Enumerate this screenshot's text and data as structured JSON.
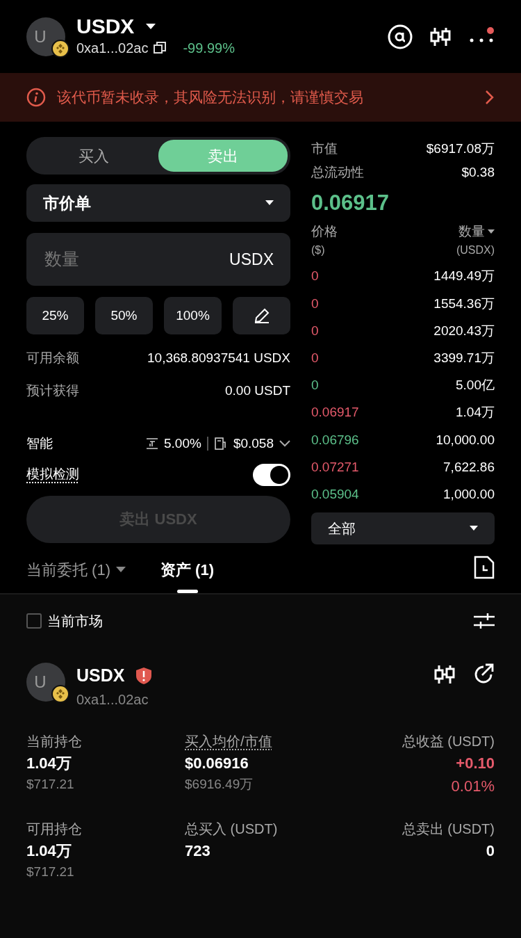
{
  "token": {
    "symbol": "USDX",
    "avatar_letter": "U",
    "address": "0xa1...02ac",
    "change": "-99.99%",
    "has_notification": true
  },
  "warning": {
    "text": "该代币暂未收录，其风险无法识别，请谨慎交易"
  },
  "trade": {
    "sides": [
      {
        "label": "买入",
        "selected": false
      },
      {
        "label": "卖出",
        "selected": true
      }
    ],
    "order_type": "市价单",
    "amount": {
      "placeholder": "数量",
      "unit": "USDX"
    },
    "presets": [
      "25%",
      "50%",
      "100%"
    ],
    "available": {
      "label": "可用余额",
      "value": "10,368.80937541 USDX"
    },
    "estimated": {
      "label": "预计获得",
      "value": "0.00 USDT"
    },
    "mode": {
      "label": "智能",
      "slippage": "5.00%",
      "gas": "$0.058"
    },
    "simulation": {
      "label": "模拟检测",
      "on": true
    },
    "submit": {
      "label": "卖出 USDX",
      "disabled": true
    }
  },
  "market": {
    "stats": [
      {
        "label": "市值",
        "value": "$6917.08万"
      },
      {
        "label": "总流动性",
        "value": "$0.38"
      }
    ],
    "price": "0.06917",
    "columns": [
      {
        "label": "价格",
        "unit": "($)"
      },
      {
        "label": "数量",
        "unit": "(USDX)"
      }
    ],
    "trades": [
      {
        "price": "0",
        "amount": "1449.49万",
        "kind": "sell"
      },
      {
        "price": "0",
        "amount": "1554.36万",
        "kind": "sell"
      },
      {
        "price": "0",
        "amount": "2020.43万",
        "kind": "sell"
      },
      {
        "price": "0",
        "amount": "3399.71万",
        "kind": "sell"
      },
      {
        "price": "0",
        "amount": "5.00亿",
        "kind": "buy"
      },
      {
        "price": "0.06917",
        "amount": "1.04万",
        "kind": "sell"
      },
      {
        "price": "0.06796",
        "amount": "10,000.00",
        "kind": "buy"
      },
      {
        "price": "0.07271",
        "amount": "7,622.86",
        "kind": "sell"
      },
      {
        "price": "0.05904",
        "amount": "1,000.00",
        "kind": "buy"
      }
    ],
    "filter": "全部"
  },
  "tabs": [
    {
      "label": "当前委托 (1)",
      "selected": false,
      "has_dropdown": true
    },
    {
      "label": "资产 (1)",
      "selected": true,
      "has_dropdown": false
    }
  ],
  "market_filter": {
    "label": "当前市场",
    "checked": false
  },
  "asset": {
    "symbol": "USDX",
    "avatar_letter": "U",
    "address": "0xa1...02ac",
    "risk_flag": true,
    "stats": [
      {
        "label": "当前持仓",
        "value": "1.04万",
        "sub": "$717.21",
        "kind": "plain",
        "has_tooltip": false
      },
      {
        "label": "买入均价/市值",
        "value": "$0.06916",
        "sub": "$6916.49万",
        "kind": "plain",
        "has_tooltip": true
      },
      {
        "label": "总收益 (USDT)",
        "value": "+0.10",
        "sub": "0.01%",
        "kind": "pnl",
        "has_tooltip": false
      },
      {
        "label": "可用持仓",
        "value": "1.04万",
        "sub": "$717.21",
        "kind": "plain",
        "has_tooltip": false
      },
      {
        "label": "总买入 (USDT)",
        "value": "723",
        "kind": "plain",
        "has_tooltip": false
      },
      {
        "label": "总卖出 (USDT)",
        "value": "0",
        "kind": "plain",
        "has_tooltip": false
      }
    ]
  }
}
